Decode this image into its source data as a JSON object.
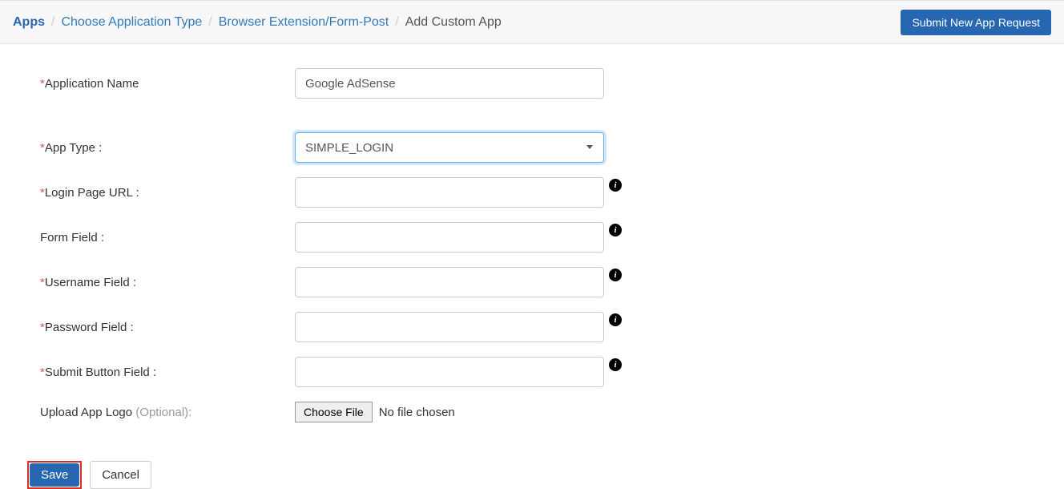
{
  "breadcrumb": {
    "apps": "Apps",
    "choose_type": "Choose Application Type",
    "browser_ext": "Browser Extension/Form-Post",
    "current": "Add Custom App"
  },
  "header": {
    "submit_button": "Submit New App Request"
  },
  "form": {
    "app_name": {
      "label": "Application Name",
      "value": "Google AdSense"
    },
    "app_type": {
      "label": "App Type :",
      "value": "SIMPLE_LOGIN"
    },
    "login_url": {
      "label": "Login Page URL :",
      "value": ""
    },
    "form_field": {
      "label": "Form Field :",
      "value": ""
    },
    "username_field": {
      "label": "Username Field :",
      "value": ""
    },
    "password_field": {
      "label": "Password Field :",
      "value": ""
    },
    "submit_field": {
      "label": "Submit Button Field :",
      "value": ""
    },
    "upload_logo": {
      "label": "Upload App Logo ",
      "optional": "(Optional):",
      "button": "Choose File",
      "status": "No file chosen"
    }
  },
  "actions": {
    "save": "Save",
    "cancel": "Cancel"
  },
  "icons": {
    "info": "i"
  }
}
